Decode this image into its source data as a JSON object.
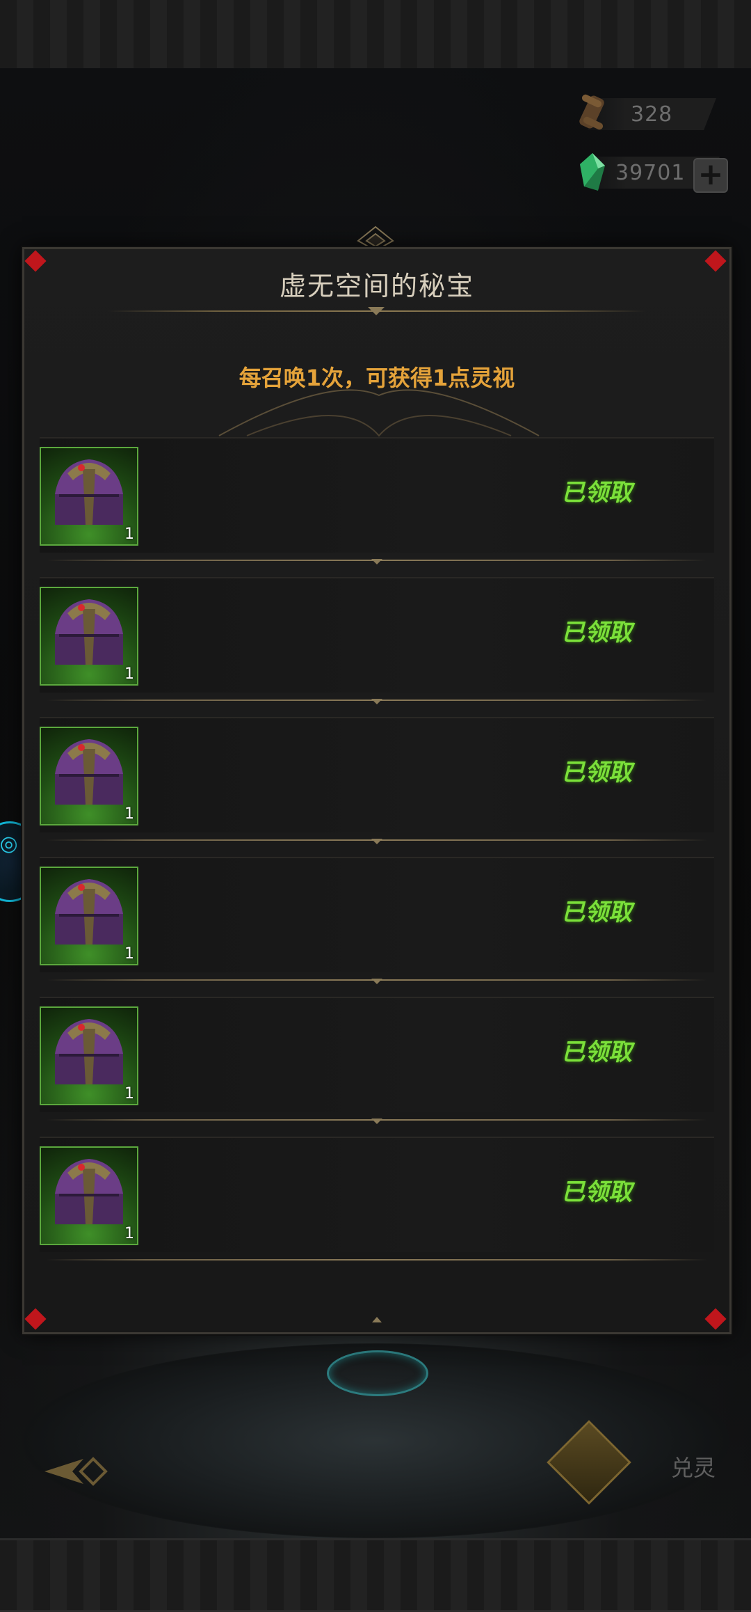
{
  "colors": {
    "accent_gold": "#e5a33a",
    "claimed_green": "#7be03a",
    "rarity_green": "#5ba83d",
    "corner_red": "#c0161c"
  },
  "currency": {
    "scroll": {
      "icon": "scroll-icon",
      "value": "328"
    },
    "gem": {
      "icon": "green-gem-icon",
      "value": "39701",
      "add_icon": "plus-icon"
    }
  },
  "modal": {
    "title": "虚无空间的秘宝",
    "subtitle": "每召唤1次，可获得1点灵视",
    "rewards": [
      {
        "item_icon": "treasure-chest-icon",
        "count": "1",
        "status": "已领取"
      },
      {
        "item_icon": "treasure-chest-icon",
        "count": "1",
        "status": "已领取"
      },
      {
        "item_icon": "treasure-chest-icon",
        "count": "1",
        "status": "已领取"
      },
      {
        "item_icon": "treasure-chest-icon",
        "count": "1",
        "status": "已领取"
      },
      {
        "item_icon": "treasure-chest-icon",
        "count": "1",
        "status": "已领取"
      },
      {
        "item_icon": "treasure-chest-icon",
        "count": "1",
        "status": "已领取"
      }
    ]
  },
  "bottom_nav": {
    "back_icon": "back-arrow-icon",
    "exchange_label": "兑灵"
  }
}
